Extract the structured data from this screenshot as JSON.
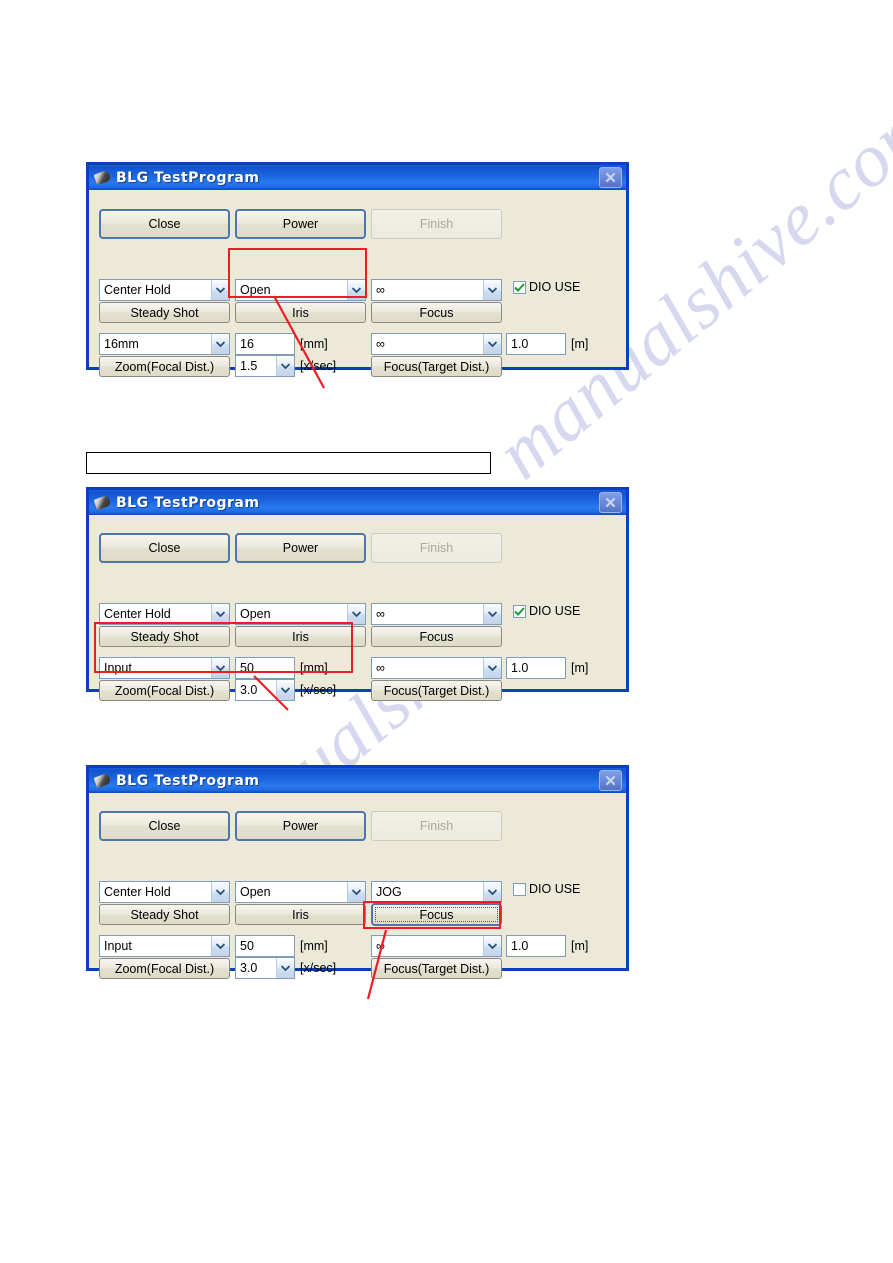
{
  "page": {
    "watermark": "manualshive.com",
    "background_color": "#ffffff"
  },
  "accent_colors": {
    "titlebar_blue": "#1b63e0",
    "window_border": "#0a3fc0",
    "client_background": "#ece9d8",
    "annotation_red": "#ee1c24",
    "combo_border": "#7f9db9"
  },
  "empty_box": {
    "label": ""
  },
  "dialogs": [
    {
      "title": "BLG TestProgram",
      "icon": "pen-icon",
      "close_label": "×",
      "buttons": {
        "close": "Close",
        "power": "Power",
        "finish": "Finish"
      },
      "row1": {
        "combo_steady": "Center Hold",
        "combo_iris": "Open",
        "combo_focus": "∞",
        "btn_steady": "Steady Shot",
        "btn_iris": "Iris",
        "btn_focus": "Focus",
        "checkbox_label": "DIO USE",
        "checkbox_checked": true
      },
      "row2": {
        "combo_zoom_mode": "16mm",
        "text_zoom_value": "16",
        "unit_mm": "[mm]",
        "combo_zoom_speed": "1.5",
        "unit_speed": "[x/sec]",
        "btn_zoom": "Zoom(Focal Dist.)",
        "combo_focus_dist": "∞",
        "text_focus_value": "1.0",
        "unit_m": "[m]",
        "btn_focus_dist": "Focus(Target Dist.)"
      },
      "highlight": "iris-group",
      "focused_button": null
    },
    {
      "title": "BLG TestProgram",
      "icon": "pen-icon",
      "close_label": "×",
      "buttons": {
        "close": "Close",
        "power": "Power",
        "finish": "Finish"
      },
      "row1": {
        "combo_steady": "Center Hold",
        "combo_iris": "Open",
        "combo_focus": "∞",
        "btn_steady": "Steady Shot",
        "btn_iris": "Iris",
        "btn_focus": "Focus",
        "checkbox_label": "DIO USE",
        "checkbox_checked": true
      },
      "row2": {
        "combo_zoom_mode": "Input",
        "text_zoom_value": "50",
        "unit_mm": "[mm]",
        "combo_zoom_speed": "3.0",
        "unit_speed": "[x/sec]",
        "btn_zoom": "Zoom(Focal Dist.)",
        "combo_focus_dist": "∞",
        "text_focus_value": "1.0",
        "unit_m": "[m]",
        "btn_focus_dist": "Focus(Target Dist.)"
      },
      "highlight": "zoom-group",
      "focused_button": null
    },
    {
      "title": "BLG TestProgram",
      "icon": "pen-icon",
      "close_label": "×",
      "buttons": {
        "close": "Close",
        "power": "Power",
        "finish": "Finish"
      },
      "row1": {
        "combo_steady": "Center Hold",
        "combo_iris": "Open",
        "combo_focus": "JOG",
        "btn_steady": "Steady Shot",
        "btn_iris": "Iris",
        "btn_focus": "Focus",
        "checkbox_label": "DIO USE",
        "checkbox_checked": false
      },
      "row2": {
        "combo_zoom_mode": "Input",
        "text_zoom_value": "50",
        "unit_mm": "[mm]",
        "combo_zoom_speed": "3.0",
        "unit_speed": "[x/sec]",
        "btn_zoom": "Zoom(Focal Dist.)",
        "combo_focus_dist": "∞",
        "text_focus_value": "1.0",
        "unit_m": "[m]",
        "btn_focus_dist": "Focus(Target Dist.)"
      },
      "highlight": "focus-dist-combo",
      "focused_button": "Focus"
    }
  ]
}
